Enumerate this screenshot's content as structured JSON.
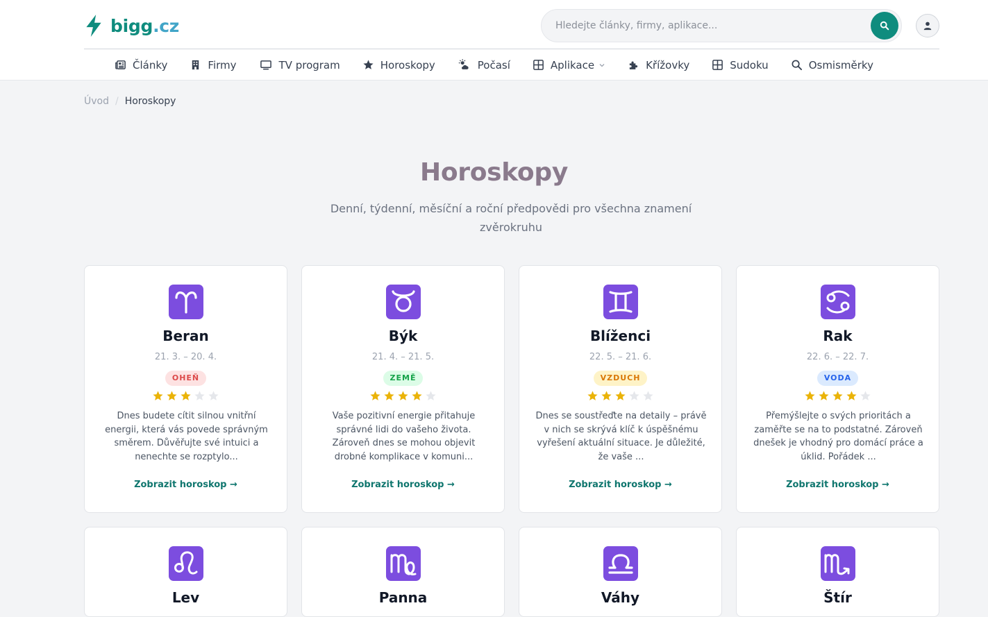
{
  "brand": {
    "name_part1": "bigg",
    "name_part2": ".cz"
  },
  "search": {
    "placeholder": "Hledejte články, firmy, aplikace..."
  },
  "nav": {
    "items": [
      {
        "label": "Články",
        "icon": "newspaper-icon"
      },
      {
        "label": "Firmy",
        "icon": "building-icon"
      },
      {
        "label": "TV program",
        "icon": "tv-icon"
      },
      {
        "label": "Horoskopy",
        "icon": "star-icon"
      },
      {
        "label": "Počasí",
        "icon": "cloud-sun-icon"
      },
      {
        "label": "Aplikace",
        "icon": "grid-icon"
      },
      {
        "label": "Křížovky",
        "icon": "puzzle-icon"
      },
      {
        "label": "Sudoku",
        "icon": "grid-icon"
      },
      {
        "label": "Osmisměrky",
        "icon": "search-icon"
      }
    ]
  },
  "breadcrumb": {
    "home": "Úvod",
    "separator": "/",
    "current": "Horoskopy"
  },
  "page": {
    "title": "Horoskopy",
    "subtitle": "Denní, týdenní, měsíční a roční předpovědi pro všechna znamení zvěrokruhu"
  },
  "colors": {
    "accent": "#0f8c7e",
    "zodiac_tile": "#7c4ddf"
  },
  "cards": [
    {
      "name": "Beran",
      "dates": "21. 3. – 20. 4.",
      "element": "OHEŇ",
      "rating": 3,
      "text": "Dnes budete cítit silnou vnitřní energii, která vás povede správným směrem. Důvěřujte své intuici a nenechte se rozptylo...",
      "link": "Zobrazit horoskop →",
      "icon": "aries-icon"
    },
    {
      "name": "Býk",
      "dates": "21. 4. – 21. 5.",
      "element": "ZEMĚ",
      "rating": 4,
      "text": "Vaše pozitivní energie přitahuje správné lidi do vašeho života. Zároveň dnes se mohou objevit drobné komplikace v komuni...",
      "link": "Zobrazit horoskop →",
      "icon": "taurus-icon"
    },
    {
      "name": "Blíženci",
      "dates": "22. 5. – 21. 6.",
      "element": "VZDUCH",
      "rating": 3,
      "text": "Dnes se soustřeďte na detaily – právě v nich se skrývá klíč k úspěšnému vyřešení aktuální situace. Je důležité, že vaše ...",
      "link": "Zobrazit horoskop →",
      "icon": "gemini-icon"
    },
    {
      "name": "Rak",
      "dates": "22. 6. – 22. 7.",
      "element": "VODA",
      "rating": 4,
      "text": "Přemýšlejte o svých prioritách a zaměřte se na to podstatné. Zároveň dnešek je vhodný pro domácí práce a úklid. Pořádek ...",
      "link": "Zobrazit horoskop →",
      "icon": "cancer-icon"
    },
    {
      "name": "Lev",
      "icon": "leo-icon"
    },
    {
      "name": "Panna",
      "icon": "virgo-icon"
    },
    {
      "name": "Váhy",
      "icon": "libra-icon"
    },
    {
      "name": "Štír",
      "icon": "scorpio-icon"
    }
  ]
}
